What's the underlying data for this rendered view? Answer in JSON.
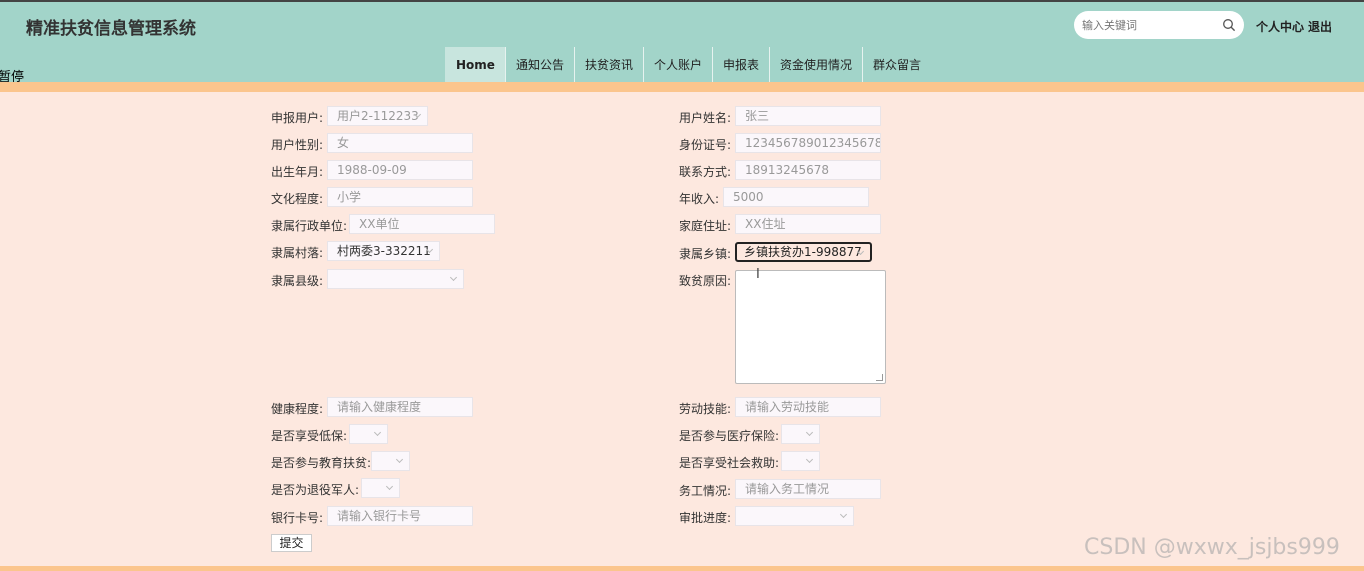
{
  "app": {
    "title": "精准扶贫信息管理系统",
    "marquee": "暂停"
  },
  "search": {
    "placeholder": "输入关键词",
    "icon": "search-icon"
  },
  "top_links": {
    "user_center": "个人中心",
    "logout": "退出"
  },
  "nav": {
    "items": [
      {
        "label": "Home",
        "active": true
      },
      {
        "label": "通知公告"
      },
      {
        "label": "扶贫资讯"
      },
      {
        "label": "个人账户"
      },
      {
        "label": "申报表"
      },
      {
        "label": "资金使用情况"
      },
      {
        "label": "群众留言"
      }
    ]
  },
  "form": {
    "applicant_user": {
      "label": "申报用户:",
      "value": "用户2-112233"
    },
    "user_name": {
      "label": "用户姓名:",
      "value": "张三"
    },
    "gender": {
      "label": "用户性别:",
      "value": "女"
    },
    "id_number": {
      "label": "身份证号:",
      "value": "123456789012345678"
    },
    "birth": {
      "label": "出生年月:",
      "value": "1988-09-09"
    },
    "contact": {
      "label": "联系方式:",
      "value": "18913245678"
    },
    "education": {
      "label": "文化程度:",
      "value": "小学"
    },
    "income": {
      "label": "年收入:",
      "value": "5000"
    },
    "admin_unit": {
      "label": "隶属行政单位:",
      "value": "XX单位"
    },
    "address": {
      "label": "家庭住址:",
      "value": "XX住址"
    },
    "village": {
      "label": "隶属村落:",
      "value": "村两委3-332211"
    },
    "township": {
      "label": "隶属乡镇:",
      "value": "乡镇扶贫办1-998877"
    },
    "county": {
      "label": "隶属县级:",
      "value": ""
    },
    "poverty_reason": {
      "label": "致贫原因:",
      "value": ""
    },
    "health": {
      "label": "健康程度:",
      "placeholder": "请输入健康程度"
    },
    "labor_skill": {
      "label": "劳动技能:",
      "placeholder": "请输入劳动技能"
    },
    "low_income": {
      "label": "是否享受低保:",
      "value": ""
    },
    "medical_insurance": {
      "label": "是否参与医疗保险:",
      "value": ""
    },
    "education_aid": {
      "label": "是否参与教育扶贫:",
      "value": ""
    },
    "social_aid": {
      "label": "是否享受社会救助:",
      "value": ""
    },
    "veteran": {
      "label": "是否为退役军人:",
      "value": ""
    },
    "work_status": {
      "label": "务工情况:",
      "placeholder": "请输入务工情况"
    },
    "bank_card": {
      "label": "银行卡号:",
      "placeholder": "请输入银行卡号"
    },
    "approval": {
      "label": "审批进度:",
      "value": ""
    },
    "submit_label": "提交"
  },
  "watermark": "CSDN @wxwx_jsjbs999",
  "colors": {
    "header": "#a2d4c9",
    "band": "#fbc58d",
    "background": "#fde8df"
  }
}
